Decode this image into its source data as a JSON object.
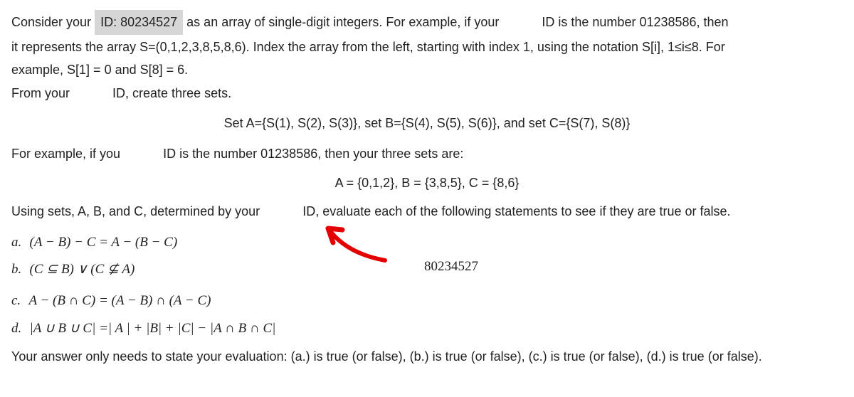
{
  "intro": {
    "consider": "Consider your ",
    "id_label": "ID: 80234527",
    "after_id": " as an array of single-digit integers. For example, if your ",
    "id_is": "ID is the number 01238586, then",
    "line2": "it represents the array S=(0,1,2,3,8,5,8,6). Index the array from the left, starting with index 1, using the notation S[i], 1≤i≤8. For",
    "line3": "example, S[1] = 0 and S[8] = 6.",
    "line4a": "From your ",
    "line4b": "ID, create three sets."
  },
  "set_def": "Set A={S(1), S(2), S(3)}, set B={S(4), S(5), S(6)}, and set C={S(7), S(8)}",
  "example": {
    "lead_a": "For example, if you ",
    "lead_b": "ID is the number 01238586, then your three sets are:",
    "sets": "A = {0,1,2}, B = {3,8,5}, C = {8,6}"
  },
  "using": {
    "lead_a": "Using sets, A, B, and C, determined by your ",
    "lead_b": "ID, evaluate each of the following statements to see if they are true or false."
  },
  "items": {
    "a_label": "a.",
    "a_math": "(A − B) − C = A − (B − C)",
    "b_label": "b.",
    "b_math": "(C ⊆ B) ∨ (C ⊈ A)",
    "c_label": "c.",
    "c_math": "A − (B ∩ C) = (A − B) ∩ (A − C)",
    "d_label": "d.",
    "d_math": "|A ∪ B ∪ C| =| A | + |B| + |C| − |A ∩ B ∩ C|"
  },
  "annotation_id": "80234527",
  "closing": "Your answer only needs to state your evaluation: (a.) is true (or false), (b.) is true (or false), (c.) is true (or false), (d.) is true (or false)."
}
